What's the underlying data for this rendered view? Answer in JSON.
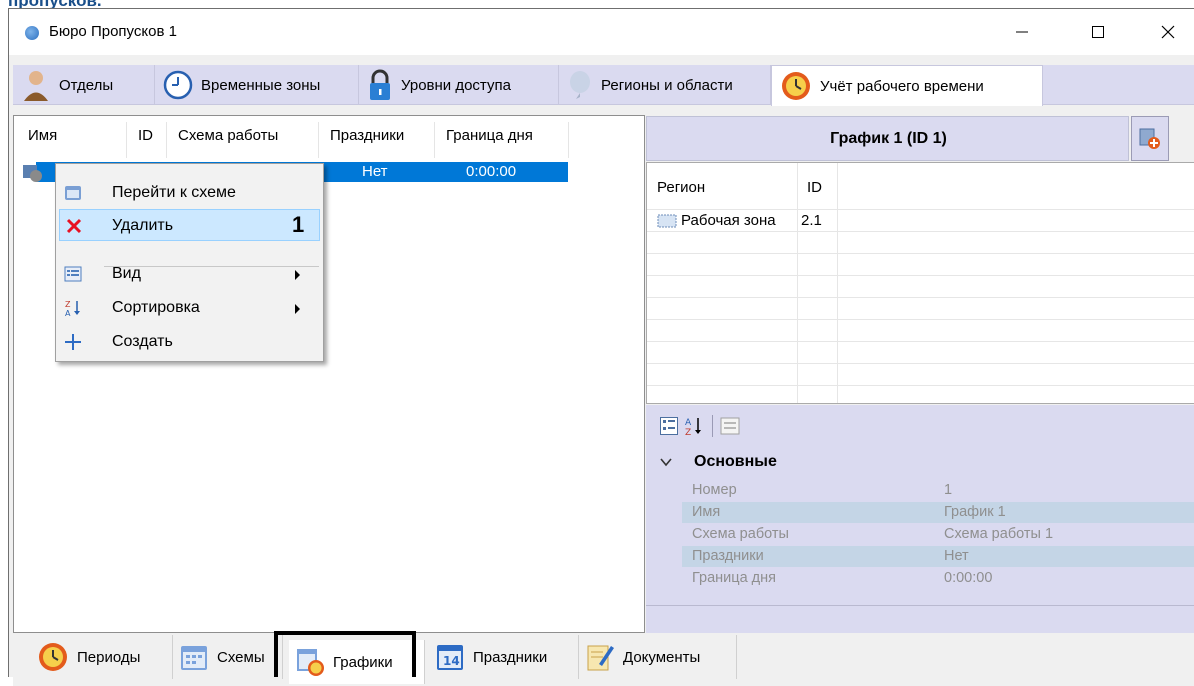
{
  "page_caption_fragment": "пропусков.",
  "window": {
    "title": "Бюро Пропусков 1",
    "controls": {
      "minimize": "—",
      "maximize": "☐",
      "close": "✕"
    }
  },
  "top_tabs": [
    {
      "label": "Отделы",
      "icon": "person-icon"
    },
    {
      "label": "Временные зоны",
      "icon": "clock-icon"
    },
    {
      "label": "Уровни доступа",
      "icon": "lock-icon"
    },
    {
      "label": "Регионы и области",
      "icon": "balloon-icon"
    },
    {
      "label": "Учёт рабочего времени",
      "icon": "time-tracking-icon",
      "active": true
    }
  ],
  "left_table": {
    "columns": [
      "Имя",
      "ID",
      "Схема работы",
      "Праздники",
      "Граница дня"
    ],
    "selected_row": {
      "holidays": "Нет",
      "day_boundary": "0:00:00"
    }
  },
  "context_menu": {
    "items": [
      {
        "label": "Перейти к схеме",
        "icon": "scheme-icon"
      },
      {
        "label": "Удалить",
        "icon": "delete-x-icon",
        "highlighted": true,
        "badge": "1"
      },
      {
        "label": "Вид",
        "icon": "view-icon",
        "submenu": true
      },
      {
        "label": "Сортировка",
        "icon": "sort-az-icon",
        "submenu": true
      },
      {
        "label": "Создать",
        "icon": "plus-icon"
      }
    ]
  },
  "right_panel": {
    "header_title": "График 1 (ID 1)",
    "grid_columns": [
      "Регион",
      "ID"
    ],
    "grid_rows": [
      {
        "region": "Рабочая зона",
        "id": "2.1"
      }
    ]
  },
  "properties": {
    "category": "Основные",
    "rows": [
      {
        "key": "Номер",
        "value": "1"
      },
      {
        "key": "Имя",
        "value": "График 1"
      },
      {
        "key": "Схема работы",
        "value": "Схема работы 1"
      },
      {
        "key": "Праздники",
        "value": "Нет"
      },
      {
        "key": "Граница дня",
        "value": "0:00:00"
      }
    ]
  },
  "bottom_tabs": [
    {
      "label": "Периоды",
      "icon": "periods-clock-icon"
    },
    {
      "label": "Схемы",
      "icon": "calendar-icon"
    },
    {
      "label": "Графики",
      "icon": "schedules-icon",
      "active": true
    },
    {
      "label": "Праздники",
      "icon": "calendar-14-icon",
      "icon_text": "14"
    },
    {
      "label": "Документы",
      "icon": "document-pen-icon"
    }
  ],
  "colors": {
    "tab_strip_bg": "#dadaf0",
    "selection_blue": "#0078d7",
    "menu_highlight": "#cce8ff",
    "delete_red": "#e81123",
    "property_shade": "#c4d5e6"
  }
}
